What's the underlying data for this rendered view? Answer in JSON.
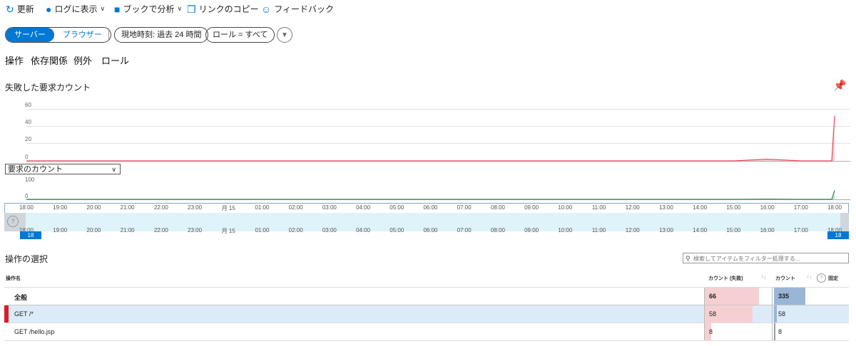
{
  "toolbar": {
    "refresh_label": "更新",
    "logs_label": "ログに表示",
    "workbook_label": "ブックで分析",
    "copy_link_label": "リンクのコピー",
    "feedback_label": "フィードバック"
  },
  "filters": {
    "server_label": "サーバー",
    "browser_label": "ブラウザー",
    "time_label": "現地時刻: 過去 24 時間",
    "role_label": "ロール = すべて"
  },
  "tabs": [
    "操作",
    "依存関係",
    "例外",
    "ロール"
  ],
  "chart_section": {
    "title": "失敗した要求カウント",
    "metric_select": "要求のカウント"
  },
  "chart_data": [
    {
      "type": "area",
      "title": "",
      "color": "#e8485a",
      "y_ticks": [
        "60",
        "40",
        "20",
        "0"
      ],
      "ylim": [
        0,
        60
      ],
      "x": [
        "18:00",
        "19:00",
        "20:00",
        "21:00",
        "22:00",
        "23:00",
        "月 15",
        "01:00",
        "02:00",
        "03:00",
        "04:00",
        "05:00",
        "06:00",
        "07:00",
        "08:00",
        "09:00",
        "10:00",
        "11:00",
        "12:00",
        "13:00",
        "14:00",
        "15:00",
        "16:00",
        "17:00",
        "18:00"
      ],
      "values": [
        0,
        0,
        0,
        0,
        0,
        0,
        0,
        0,
        0,
        0,
        0,
        0,
        0,
        0,
        0,
        0,
        0,
        0,
        0,
        0,
        0,
        0,
        2,
        0,
        52
      ]
    },
    {
      "type": "area",
      "title": "",
      "color": "#2e8b57",
      "y_ticks": [
        "100",
        "0"
      ],
      "ylim": [
        0,
        100
      ],
      "x": [
        "18:00",
        "19:00",
        "20:00",
        "21:00",
        "22:00",
        "23:00",
        "月 15",
        "01:00",
        "02:00",
        "03:00",
        "04:00",
        "05:00",
        "06:00",
        "07:00",
        "08:00",
        "09:00",
        "10:00",
        "11:00",
        "12:00",
        "13:00",
        "14:00",
        "15:00",
        "16:00",
        "17:00",
        "18:00"
      ],
      "values": [
        0,
        0,
        0,
        0,
        0,
        0,
        0,
        0,
        0,
        0,
        0,
        0,
        0,
        0,
        0,
        0,
        0,
        0,
        0,
        0,
        0,
        0,
        2,
        0,
        55
      ]
    }
  ],
  "timeline": {
    "labels": [
      "18:00",
      "19:00",
      "20:00",
      "21:00",
      "22:00",
      "23:00",
      "月 15",
      "01:00",
      "02:00",
      "03:00",
      "04:00",
      "05:00",
      "06:00",
      "07:00",
      "08:00",
      "09:00",
      "10:00",
      "11:00",
      "12:00",
      "13:00",
      "14:00",
      "15:00",
      "16:00",
      "17:00",
      "18:00"
    ],
    "start_tag": "18",
    "end_tag": "18"
  },
  "operations": {
    "title": "操作の選択",
    "search_placeholder": "検索してアイテムをフィルター処理する...",
    "headers": {
      "name": "操作名",
      "failed": "カウント (失敗)",
      "count": "カウント",
      "pin": "固定"
    },
    "max_failed": 66,
    "max_count": 335,
    "rows": [
      {
        "name": "全般",
        "failed": 66,
        "count": 335,
        "bold": true,
        "selected": false
      },
      {
        "name": "GET /*",
        "failed": 58,
        "count": 58,
        "bold": false,
        "selected": true
      },
      {
        "name": "GET /hello.jsp",
        "failed": 8,
        "count": 8,
        "bold": false,
        "selected": false
      }
    ]
  }
}
